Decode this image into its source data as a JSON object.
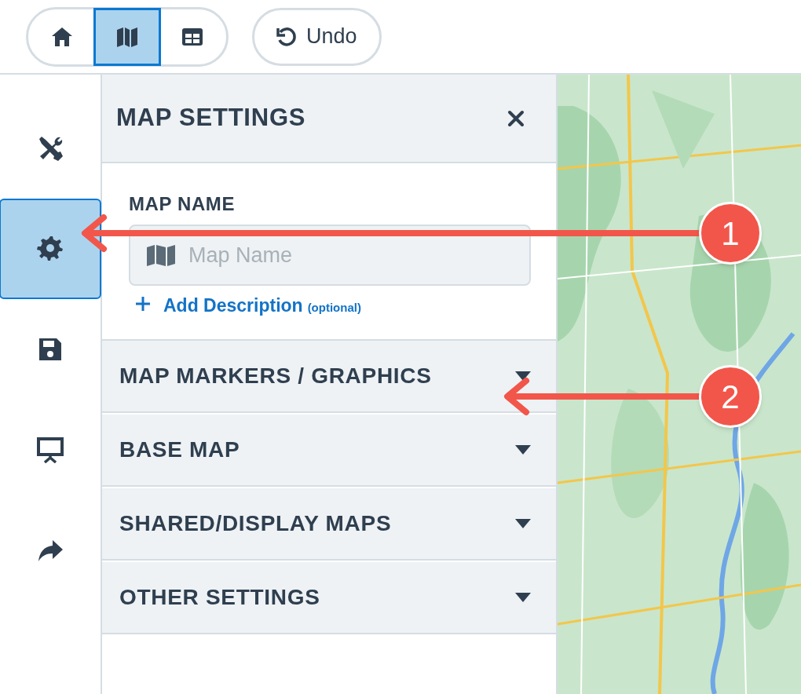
{
  "toolbar": {
    "view_buttons": [
      {
        "kind": "home",
        "selected": false
      },
      {
        "kind": "map",
        "selected": true
      },
      {
        "kind": "table",
        "selected": false
      }
    ],
    "undo": {
      "label": "Undo"
    }
  },
  "sidebar": {
    "items": [
      {
        "kind": "tools",
        "selected": false
      },
      {
        "kind": "settings",
        "selected": true
      },
      {
        "kind": "save",
        "selected": false
      },
      {
        "kind": "present",
        "selected": false
      },
      {
        "kind": "share",
        "selected": false
      }
    ]
  },
  "panel": {
    "title": "MAP SETTINGS",
    "map_name": {
      "label": "MAP NAME",
      "placeholder": "Map Name"
    },
    "add_description": {
      "label": "Add Description",
      "note": "(optional)"
    },
    "sections": [
      {
        "title": "MAP MARKERS / GRAPHICS",
        "expanded": false
      },
      {
        "title": "BASE MAP",
        "expanded": false
      },
      {
        "title": "SHARED/DISPLAY MAPS",
        "expanded": false
      },
      {
        "title": "OTHER SETTINGS",
        "expanded": false
      }
    ]
  },
  "callouts": [
    {
      "number": "1"
    },
    {
      "number": "2"
    }
  ]
}
